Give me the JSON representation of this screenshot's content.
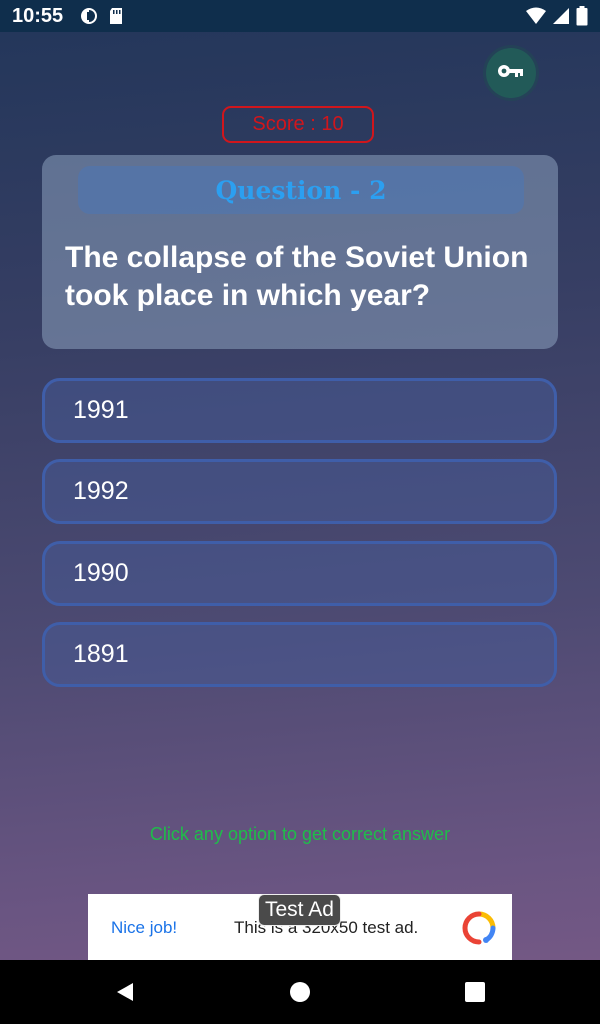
{
  "status_bar": {
    "time": "10:55"
  },
  "score": {
    "label": "Score : 10"
  },
  "question": {
    "number_label": "Question - 2",
    "text": "The collapse of the Soviet Union took place in which year?"
  },
  "options": [
    {
      "label": "1991"
    },
    {
      "label": "1992"
    },
    {
      "label": "1990"
    },
    {
      "label": "1891"
    }
  ],
  "hint": "Click any option to get correct answer",
  "ad": {
    "badge": "Test Ad",
    "cta": "Nice job!",
    "description": "This is a 320x50 test ad."
  },
  "colors": {
    "score": "#d0161c",
    "question_number": "#2c9ff0",
    "hint": "#1fbd4a",
    "option_border": "#3f5ea9",
    "key_button": "#225a58"
  },
  "icons": {
    "key_button": "key-icon",
    "nav": [
      "back-icon",
      "home-icon",
      "recents-icon"
    ]
  }
}
